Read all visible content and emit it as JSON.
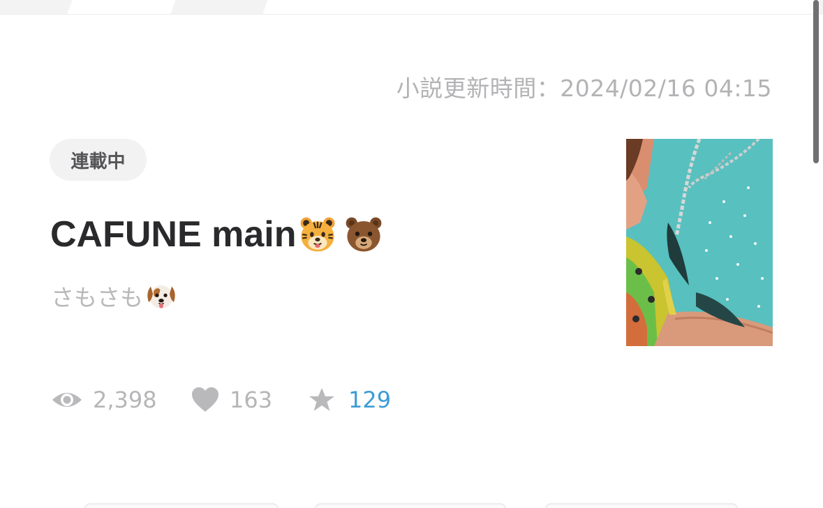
{
  "header": {
    "update_time": "小説更新時間：2024/02/16 04:15"
  },
  "novel": {
    "status": "連載中",
    "title": "CAFUNE main",
    "title_emojis": [
      "tiger-face",
      "bear-face"
    ],
    "author": "さもさも",
    "author_emoji": "dog-face",
    "stats": {
      "views": "2,398",
      "likes": "163",
      "stars": "129"
    }
  },
  "icons": {
    "views": "eye-icon",
    "likes": "heart-icon",
    "stars": "star-icon"
  },
  "colors": {
    "star_count": "#3d9bd6",
    "muted_text": "#b6b6b9",
    "title_text": "#2a2a2c",
    "badge_bg": "#f2f2f3"
  }
}
